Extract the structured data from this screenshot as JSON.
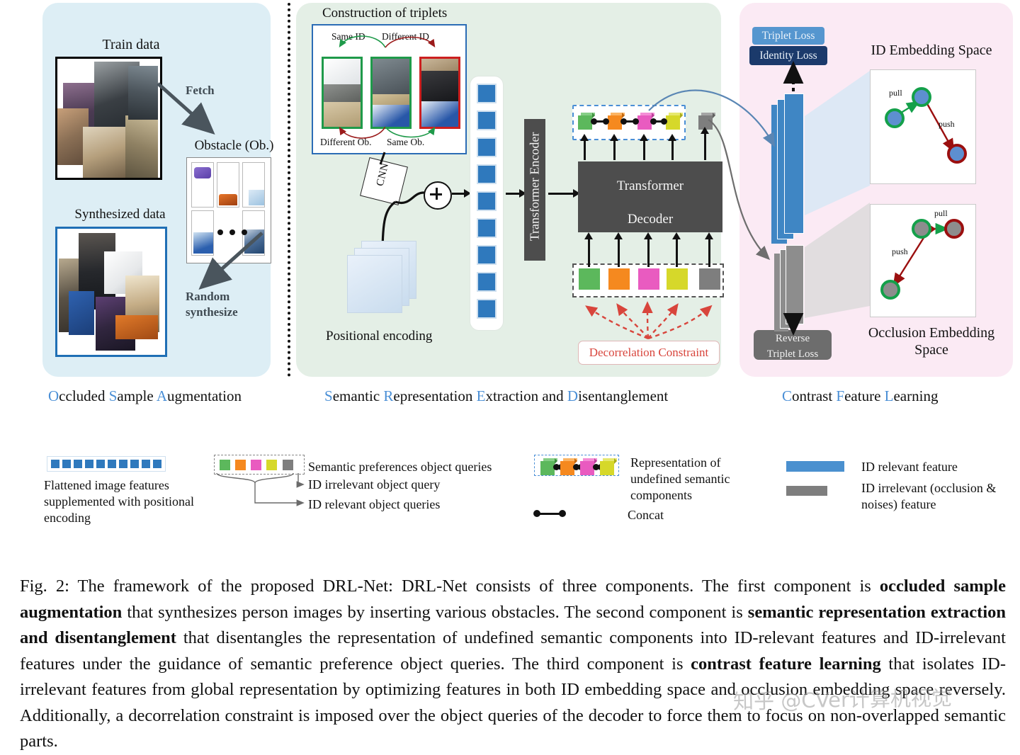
{
  "figure": {
    "id": "Fig. 2",
    "caption_parts": [
      {
        "t": "Fig. 2: The framework of the proposed DRL-Net: DRL-Net consists of three components. The first component is ",
        "b": false
      },
      {
        "t": "occluded sample augmentation",
        "b": true
      },
      {
        "t": " that synthesizes person images by inserting various obstacles. The second component is ",
        "b": false
      },
      {
        "t": "semantic representation extraction and disentanglement",
        "b": true
      },
      {
        "t": " that disentangles the representation of undefined semantic components into ID-relevant features and ID-irrelevant features under the guidance of semantic preference object queries. The third component is ",
        "b": false
      },
      {
        "t": "contrast feature learning",
        "b": true
      },
      {
        "t": " that isolates ID-irrelevant features from global representation by optimizing features in both ID embedding space and occlusion embedding space reversely. Additionally, a decorrelation constraint is imposed over the object queries of the decoder to force them to focus on non-overlapped semantic parts.",
        "b": false
      }
    ],
    "watermark": "知乎 @CVer计算机视觉"
  },
  "panel_osa": {
    "title_parts": [
      {
        "t": "O",
        "cap": true
      },
      {
        "t": "ccluded ",
        "cap": false
      },
      {
        "t": "S",
        "cap": true
      },
      {
        "t": "ample ",
        "cap": false
      },
      {
        "t": "A",
        "cap": true
      },
      {
        "t": "ugmentation",
        "cap": false
      }
    ],
    "train_data_label": "Train data",
    "synthesized_label": "Synthesized data",
    "obstacle_label": "Obstacle (Ob.)",
    "fetch_label": "Fetch",
    "random_synthesize_label": "Random\nsynthesize",
    "bg_color": "#ddeef5",
    "train_box_border": "#000000",
    "synth_box_border": "#1f6fb5"
  },
  "panel_sred": {
    "title_parts": [
      {
        "t": "S",
        "cap": true
      },
      {
        "t": "emantic ",
        "cap": false
      },
      {
        "t": "R",
        "cap": true
      },
      {
        "t": "epresentation ",
        "cap": false
      },
      {
        "t": "E",
        "cap": true
      },
      {
        "t": "xtraction and ",
        "cap": false
      },
      {
        "t": "D",
        "cap": true
      },
      {
        "t": "isentanglement",
        "cap": false
      }
    ],
    "construction_title": "Construction of triplets",
    "triplet_labels": {
      "same_id": "Same ID",
      "different_id": "Different ID",
      "different_ob": "Different Ob.",
      "same_ob": "Same Ob."
    },
    "cnn_label": "CNN",
    "plus_symbol": "+",
    "positional_encoding_label": "Positional encoding",
    "encoder_label": "Transformer Encoder",
    "decoder_label_line1": "Transformer",
    "decoder_label_line2": "Decoder",
    "decorrelation_label": "Decorrelation Constraint",
    "decorrelation_color": "#d8453c",
    "bg_color": "#e4efe6",
    "flattened_count": 9,
    "flattened_color": "#2f79bd",
    "query_colors": [
      "#5cb85c",
      "#f5891f",
      "#e95bc0",
      "#d6d82a",
      "#7e7e7e"
    ]
  },
  "panel_cfl": {
    "title_parts": [
      {
        "t": "C",
        "cap": true
      },
      {
        "t": "ontrast ",
        "cap": false
      },
      {
        "t": "F",
        "cap": true
      },
      {
        "t": "eature ",
        "cap": false
      },
      {
        "t": "L",
        "cap": true
      },
      {
        "t": "earning",
        "cap": false
      }
    ],
    "triplet_loss_label": "Triplet Loss",
    "identity_loss_label": "Identity Loss",
    "reverse_triplet_loss_line1": "Reverse",
    "reverse_triplet_loss_line2": "Triplet Loss",
    "id_embedding_space_label": "ID Embedding Space",
    "occlusion_embedding_space_label": "Occlusion Embedding\nSpace",
    "pull_label": "pull",
    "push_label": "push",
    "bg_color": "#fbeaf4",
    "triplet_loss_color": "#5596cf",
    "identity_loss_color": "#1b3a6b",
    "reverse_loss_color": "#6d6d6d",
    "id_feature_color": "#4a90cf",
    "occ_feature_color": "#7e7e7e"
  },
  "legend": {
    "item1_text": "Flattened image features supplemented with positional encoding",
    "item2_title": "Semantic preferences object queries",
    "item2_sub1": "ID irrelevant object query",
    "item2_sub2": "ID relevant object queries",
    "item3_text": "Representation of undefined semantic components",
    "item3_concat": "Concat",
    "item4_text1": "ID relevant  feature",
    "item4_text2": "ID irrelevant (occlusion & noises) feature",
    "flattened_squares": 10,
    "blue": "#2f79bd",
    "query_colors": [
      "#5cb85c",
      "#f5891f",
      "#e95bc0",
      "#d6d82a",
      "#7e7e7e"
    ]
  }
}
